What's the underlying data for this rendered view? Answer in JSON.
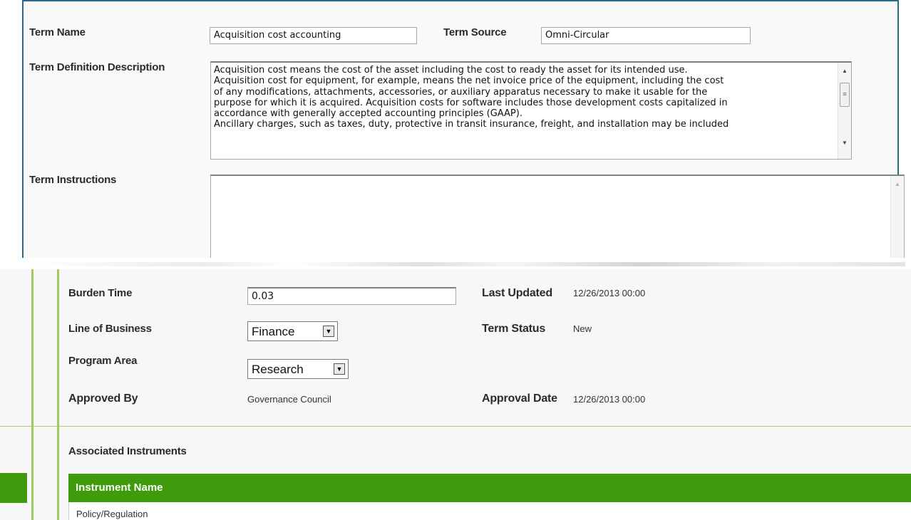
{
  "term_form": {
    "term_name_label": "Term Name",
    "term_name_value": "Acquisition cost accounting",
    "term_source_label": "Term Source",
    "term_source_value": "Omni-Circular",
    "definition_label": "Term Definition Description",
    "definition_lines": [
      "Acquisition cost means the cost of the asset including the cost to ready the asset for its intended use.",
      "Acquisition cost for equipment, for example, means the net invoice price of the equipment, including the cost",
      "of any modifications, attachments, accessories, or auxiliary apparatus necessary to make it usable for the",
      "purpose for which it is acquired. Acquisition costs for software includes those development costs capitalized in",
      "accordance with generally accepted accounting principles (GAAP).",
      "Ancillary charges, such as taxes, duty, protective in transit insurance, freight, and installation may be included"
    ],
    "instructions_label": "Term Instructions",
    "instructions_value": ""
  },
  "details": {
    "burden_time_label": "Burden Time",
    "burden_time_value": "0.03",
    "last_updated_label": "Last Updated",
    "last_updated_value": "12/26/2013 00:00",
    "line_of_business_label": "Line of Business",
    "line_of_business_value": "Finance",
    "term_status_label": "Term Status",
    "term_status_value": "New",
    "program_area_label": "Program Area",
    "program_area_value": "Research",
    "approved_by_label": "Approved By",
    "approved_by_value": "Governance Council",
    "approval_date_label": "Approval Date",
    "approval_date_value": "12/26/2013 00:00"
  },
  "instruments": {
    "section_label": "Associated Instruments",
    "column_header": "Instrument Name",
    "rows": [
      "Policy/Regulation"
    ]
  },
  "colors": {
    "panel_border": "#2a6a89",
    "grid_header": "#3f9a0c",
    "accent_line": "#9ccc5a"
  }
}
